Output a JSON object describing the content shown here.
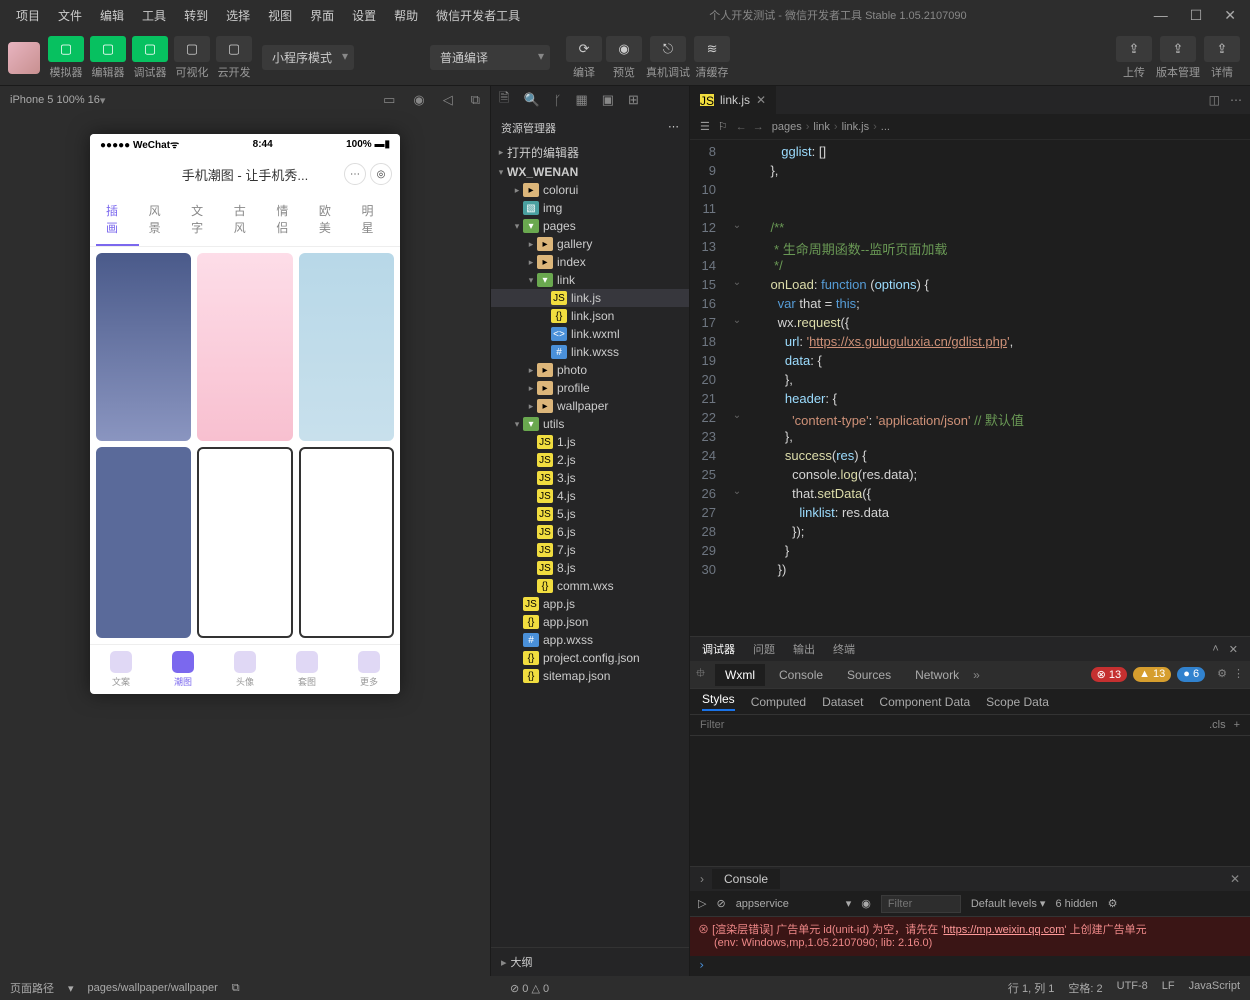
{
  "menus": [
    "项目",
    "文件",
    "编辑",
    "工具",
    "转到",
    "选择",
    "视图",
    "界面",
    "设置",
    "帮助",
    "微信开发者工具"
  ],
  "window_title": "个人开发测试 - 微信开发者工具 Stable 1.05.2107090",
  "toolbar": {
    "groups": [
      {
        "labels": [
          "模拟器",
          "编辑器",
          "调试器"
        ],
        "green": true
      },
      {
        "labels": [
          "可视化"
        ],
        "green": false
      },
      {
        "labels": [
          "云开发"
        ],
        "green": false
      }
    ],
    "mode_dropdown": "小程序模式",
    "compile_dropdown": "普通编译",
    "actions": [
      {
        "label": "编译"
      },
      {
        "label": "预览"
      },
      {
        "label": "真机调试"
      },
      {
        "label": "清缓存"
      }
    ],
    "right": [
      {
        "label": "上传"
      },
      {
        "label": "版本管理"
      },
      {
        "label": "详情"
      }
    ]
  },
  "sim": {
    "device": "iPhone 5 100% 16",
    "status_left": "●●●●● WeChat",
    "status_time": "8:44",
    "status_right": "100%",
    "app_title": "手机潮图 - 让手机秀...",
    "tabs": [
      "插画",
      "风景",
      "文字",
      "古风",
      "情侣",
      "欧美",
      "明星"
    ],
    "nav": [
      "文案",
      "潮图",
      "头像",
      "套图",
      "更多"
    ],
    "nav_active": 1
  },
  "explorer": {
    "title": "资源管理器",
    "sections": {
      "opened": "打开的编辑器",
      "project": "WX_WENAN",
      "outline": "大纲"
    },
    "tree": [
      {
        "d": 1,
        "t": "folder",
        "n": "colorui"
      },
      {
        "d": 1,
        "t": "img",
        "n": "img"
      },
      {
        "d": 1,
        "t": "folder-open",
        "n": "pages",
        "open": true
      },
      {
        "d": 2,
        "t": "folder",
        "n": "gallery"
      },
      {
        "d": 2,
        "t": "folder",
        "n": "index"
      },
      {
        "d": 2,
        "t": "folder-open",
        "n": "link",
        "open": true
      },
      {
        "d": 3,
        "t": "js",
        "n": "link.js",
        "active": true
      },
      {
        "d": 3,
        "t": "json",
        "n": "link.json"
      },
      {
        "d": 3,
        "t": "wxml",
        "n": "link.wxml"
      },
      {
        "d": 3,
        "t": "wxss",
        "n": "link.wxss"
      },
      {
        "d": 2,
        "t": "folder",
        "n": "photo"
      },
      {
        "d": 2,
        "t": "folder",
        "n": "profile"
      },
      {
        "d": 2,
        "t": "folder",
        "n": "wallpaper"
      },
      {
        "d": 1,
        "t": "folder-open",
        "n": "utils",
        "open": true
      },
      {
        "d": 2,
        "t": "js",
        "n": "1.js"
      },
      {
        "d": 2,
        "t": "js",
        "n": "2.js"
      },
      {
        "d": 2,
        "t": "js",
        "n": "3.js"
      },
      {
        "d": 2,
        "t": "js",
        "n": "4.js"
      },
      {
        "d": 2,
        "t": "js",
        "n": "5.js"
      },
      {
        "d": 2,
        "t": "js",
        "n": "6.js"
      },
      {
        "d": 2,
        "t": "js",
        "n": "7.js"
      },
      {
        "d": 2,
        "t": "js",
        "n": "8.js"
      },
      {
        "d": 2,
        "t": "json",
        "n": "comm.wxs"
      },
      {
        "d": 1,
        "t": "js",
        "n": "app.js"
      },
      {
        "d": 1,
        "t": "json",
        "n": "app.json"
      },
      {
        "d": 1,
        "t": "wxss",
        "n": "app.wxss"
      },
      {
        "d": 1,
        "t": "json",
        "n": "project.config.json"
      },
      {
        "d": 1,
        "t": "json",
        "n": "sitemap.json"
      }
    ]
  },
  "editor": {
    "tab": "link.js",
    "crumbs": [
      "pages",
      "link",
      "link.js",
      "..."
    ],
    "first_line": 8,
    "fold_markers": {
      "12": "⌄",
      "15": "⌄",
      "17": "⌄",
      "22": "⌄",
      "26": "⌄"
    },
    "code": [
      "       <span class='c-prop'>gglist</span>: []",
      "    },",
      "",
      "",
      "    <span class='c-comment'>/**</span>",
      "<span class='c-comment'>     * 生命周期函数--监听页面加载</span>",
      "<span class='c-comment'>     */</span>",
      "    <span class='c-func'>onLoad</span>: <span class='c-key'>function</span> (<span class='c-param'>options</span>) {",
      "      <span class='c-key'>var</span> that = <span class='c-key'>this</span>;",
      "      wx.<span class='c-func'>request</span>({",
      "        <span class='c-prop'>url</span>: <span class='c-str'>'</span><span class='c-str-u'>https://xs.guluguluxia.cn/gdlist.php</span><span class='c-str'>'</span>,",
      "        <span class='c-prop'>data</span>: {",
      "        },",
      "        <span class='c-prop'>header</span>: {",
      "          <span class='c-str'>'content-type'</span>: <span class='c-str'>'application/json'</span> <span class='c-comment'>// 默认值</span>",
      "        },",
      "        <span class='c-func'>success</span>(<span class='c-param'>res</span>) {",
      "          console.<span class='c-func'>log</span>(res.data);",
      "          that.<span class='c-func'>setData</span>({",
      "            <span class='c-prop'>linklist</span>: res.data",
      "          });",
      "        }",
      "      })"
    ]
  },
  "debugger": {
    "hdr": [
      "调试器",
      "问题",
      "输出",
      "终端"
    ],
    "tabs": [
      "Wxml",
      "Console",
      "Sources",
      "Network"
    ],
    "badges": {
      "err": "13",
      "warn": "13",
      "info": "6"
    },
    "sub": [
      "Styles",
      "Computed",
      "Dataset",
      "Component Data",
      "Scope Data"
    ],
    "filter_placeholder": "Filter",
    "cls": ".cls"
  },
  "console": {
    "title": "Console",
    "context": "appservice",
    "filter_placeholder": "Filter",
    "levels": "Default levels",
    "hidden": "6 hidden",
    "error_line1_a": "[渲染层错误] 广告单元 id(unit-id) 为空，请先在 '",
    "error_url": "https://mp.weixin.qq.com",
    "error_line1_b": "' 上创建广告单元",
    "error_line2": "(env: Windows,mp,1.05.2107090; lib: 2.16.0)"
  },
  "status": {
    "left_label": "页面路径",
    "path": "pages/wallpaper/wallpaper",
    "diag": "⊘ 0 △ 0",
    "right": [
      "行 1, 列 1",
      "空格: 2",
      "UTF-8",
      "LF",
      "JavaScript"
    ]
  }
}
